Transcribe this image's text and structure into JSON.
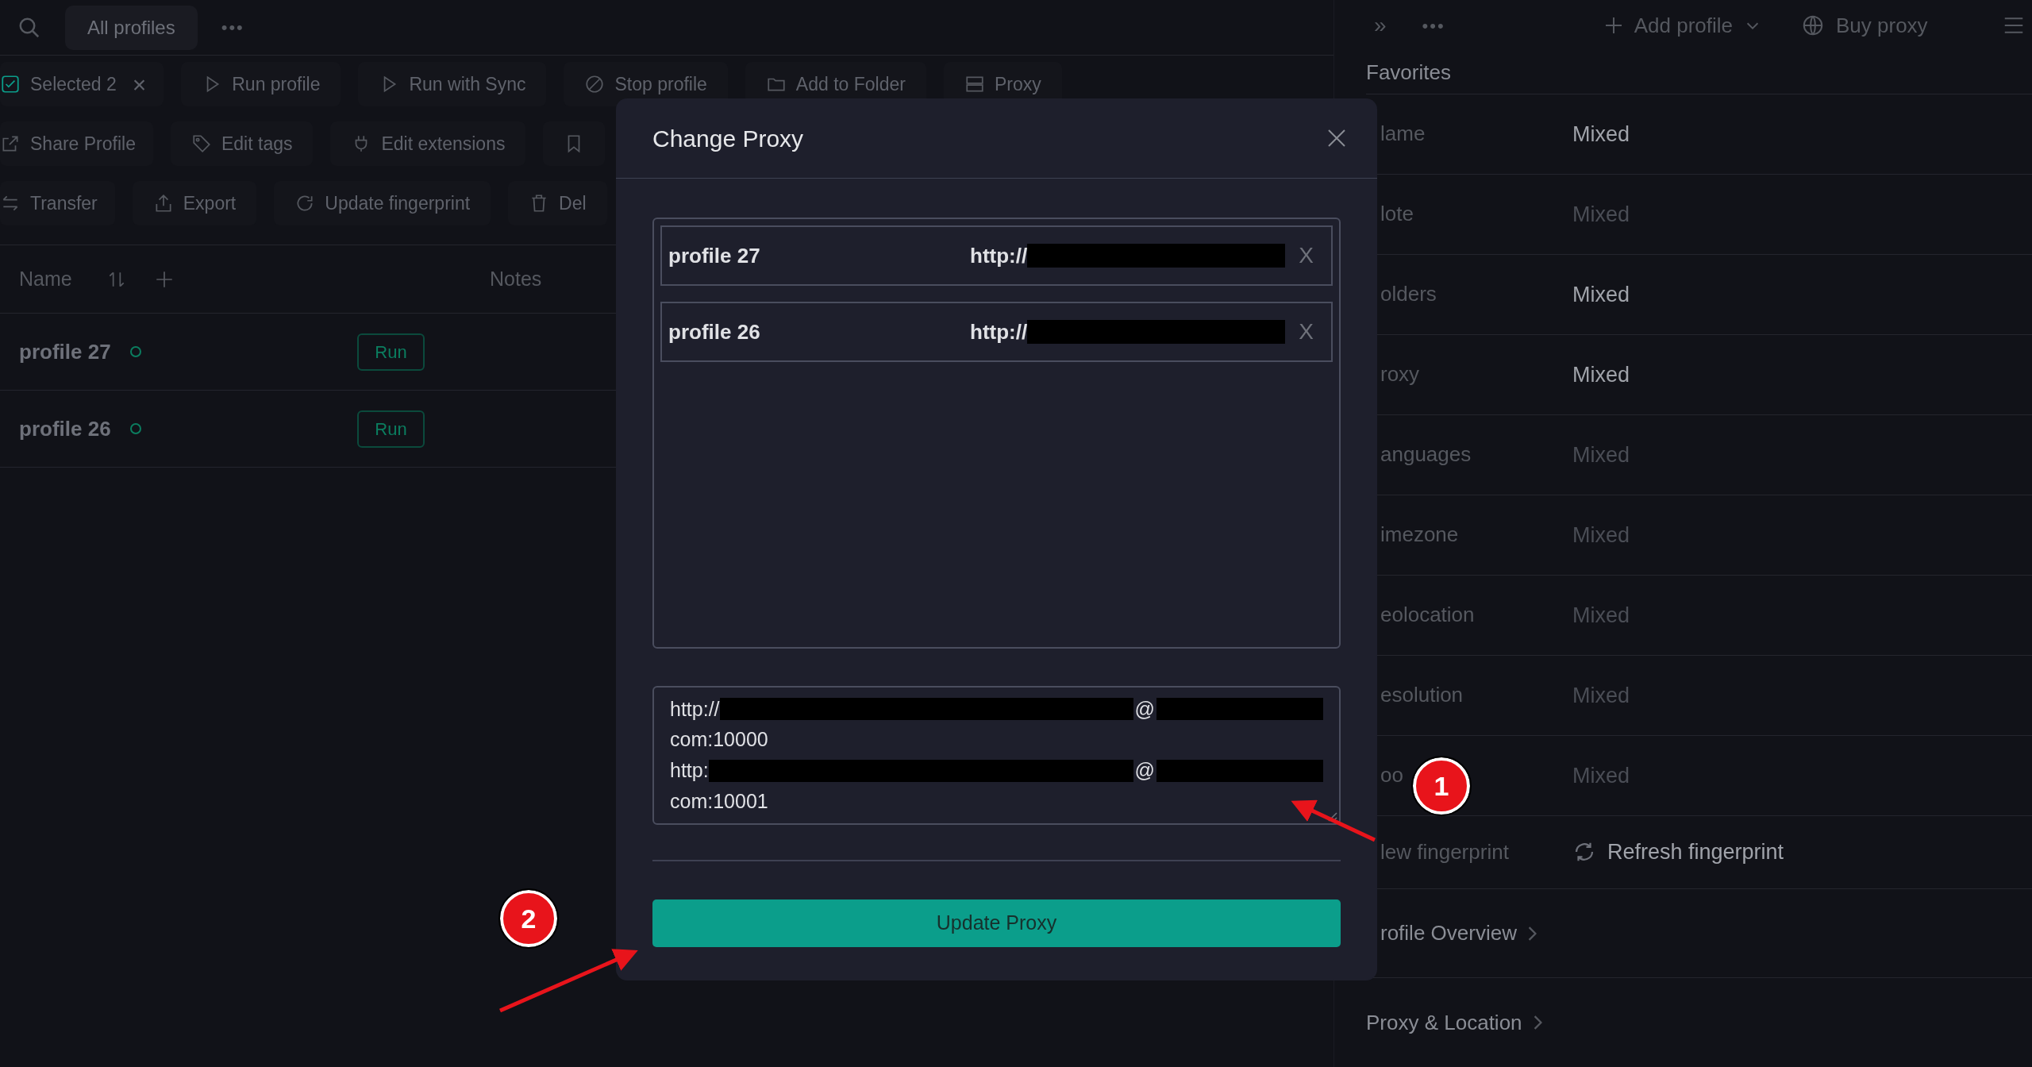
{
  "top_bar": {
    "tab": "All profiles",
    "more": "•••"
  },
  "toolbar": [
    [
      {
        "label": "Selected 2",
        "clear": "×"
      },
      {
        "label": "Run profile"
      },
      {
        "label": "Run with Sync"
      },
      {
        "label": "Stop profile"
      },
      {
        "label": "Add to Folder"
      },
      {
        "label": "Proxy"
      }
    ],
    [
      {
        "label": "Share Profile"
      },
      {
        "label": "Edit tags"
      },
      {
        "label": "Edit extensions"
      }
    ],
    [
      {
        "label": "Transfer"
      },
      {
        "label": "Export"
      },
      {
        "label": "Update fingerprint"
      },
      {
        "label": "Del"
      }
    ]
  ],
  "table": {
    "columns": [
      "Name",
      "Notes"
    ],
    "rows": [
      {
        "name": "profile 27",
        "action": "Run"
      },
      {
        "name": "profile 26",
        "action": "Run"
      }
    ]
  },
  "right_header": {
    "expand": "»",
    "more": "•••",
    "add_profile": "Add profile",
    "buy_proxy": "Buy proxy"
  },
  "details": {
    "title": "Favorites",
    "fields": [
      {
        "label": "lame",
        "value": "Mixed",
        "emphasized": true
      },
      {
        "label": "lote",
        "value": "Mixed",
        "emphasized": false
      },
      {
        "label": "olders",
        "value": "Mixed",
        "emphasized": true
      },
      {
        "label": "roxy",
        "value": "Mixed",
        "emphasized": true
      },
      {
        "label": "anguages",
        "value": "Mixed",
        "emphasized": false
      },
      {
        "label": "imezone",
        "value": "Mixed",
        "emphasized": false
      },
      {
        "label": "eolocation",
        "value": "Mixed",
        "emphasized": false
      },
      {
        "label": "esolution",
        "value": "Mixed",
        "emphasized": false
      },
      {
        "label": "oo",
        "value": "Mixed",
        "emphasized": false
      }
    ],
    "fingerprint": {
      "label": "lew fingerprint",
      "action": "Refresh fingerprint"
    },
    "sections": [
      "rofile Overview",
      "Proxy & Location"
    ]
  },
  "modal": {
    "title": "Change Proxy",
    "items": [
      {
        "name": "profile 27",
        "proxy": "http://",
        "remove": "X"
      },
      {
        "name": "profile 26",
        "proxy": "http://",
        "remove": "X"
      }
    ],
    "proxy_lines": [
      {
        "kind": "redacted",
        "start": "http://",
        "middle": "@"
      },
      {
        "kind": "text",
        "text": "com:10000"
      },
      {
        "kind": "redacted",
        "start": "http:",
        "middle": "@"
      },
      {
        "kind": "text",
        "text": "com:10001"
      }
    ],
    "submit": "Update Proxy"
  },
  "callouts": [
    "1",
    "2"
  ]
}
